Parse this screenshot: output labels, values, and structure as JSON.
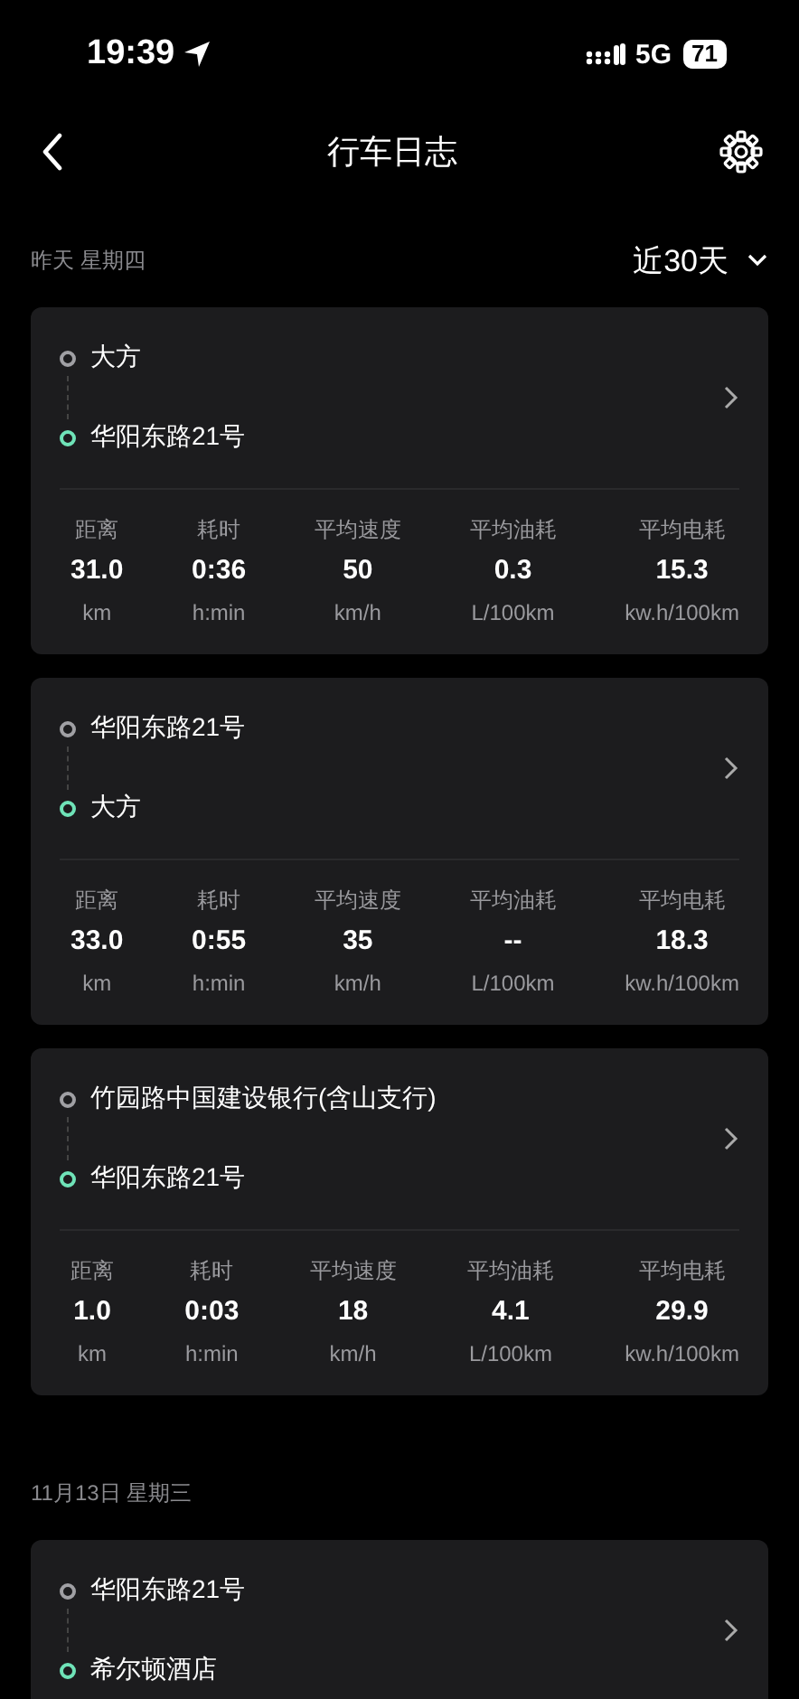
{
  "status_bar": {
    "time": "19:39",
    "network": "5G",
    "battery": "71"
  },
  "header": {
    "title": "行车日志"
  },
  "filter": {
    "label": "近30天"
  },
  "sections": [
    {
      "date": "昨天 星期四",
      "trips": [
        {
          "stops": [
            {
              "kind": "origin",
              "name": "大方"
            },
            {
              "kind": "destination",
              "name": "华阳东路21号"
            }
          ],
          "stats": [
            {
              "label": "距离",
              "value": "31.0",
              "unit": "km"
            },
            {
              "label": "耗时",
              "value": "0:36",
              "unit": "h:min"
            },
            {
              "label": "平均速度",
              "value": "50",
              "unit": "km/h"
            },
            {
              "label": "平均油耗",
              "value": "0.3",
              "unit": "L/100km"
            },
            {
              "label": "平均电耗",
              "value": "15.3",
              "unit": "kw.h/100km"
            }
          ]
        },
        {
          "stops": [
            {
              "kind": "origin",
              "name": "华阳东路21号"
            },
            {
              "kind": "destination",
              "name": "大方"
            }
          ],
          "stats": [
            {
              "label": "距离",
              "value": "33.0",
              "unit": "km"
            },
            {
              "label": "耗时",
              "value": "0:55",
              "unit": "h:min"
            },
            {
              "label": "平均速度",
              "value": "35",
              "unit": "km/h"
            },
            {
              "label": "平均油耗",
              "value": "--",
              "unit": "L/100km"
            },
            {
              "label": "平均电耗",
              "value": "18.3",
              "unit": "kw.h/100km"
            }
          ]
        },
        {
          "stops": [
            {
              "kind": "origin",
              "name": "竹园路中国建设银行(含山支行)"
            },
            {
              "kind": "destination",
              "name": "华阳东路21号"
            }
          ],
          "stats": [
            {
              "label": "距离",
              "value": "1.0",
              "unit": "km"
            },
            {
              "label": "耗时",
              "value": "0:03",
              "unit": "h:min"
            },
            {
              "label": "平均速度",
              "value": "18",
              "unit": "km/h"
            },
            {
              "label": "平均油耗",
              "value": "4.1",
              "unit": "L/100km"
            },
            {
              "label": "平均电耗",
              "value": "29.9",
              "unit": "kw.h/100km"
            }
          ]
        }
      ]
    },
    {
      "date": "11月13日 星期三",
      "trips": [
        {
          "stops": [
            {
              "kind": "origin",
              "name": "华阳东路21号"
            },
            {
              "kind": "destination",
              "name": "希尔顿酒店"
            }
          ]
        }
      ]
    }
  ]
}
